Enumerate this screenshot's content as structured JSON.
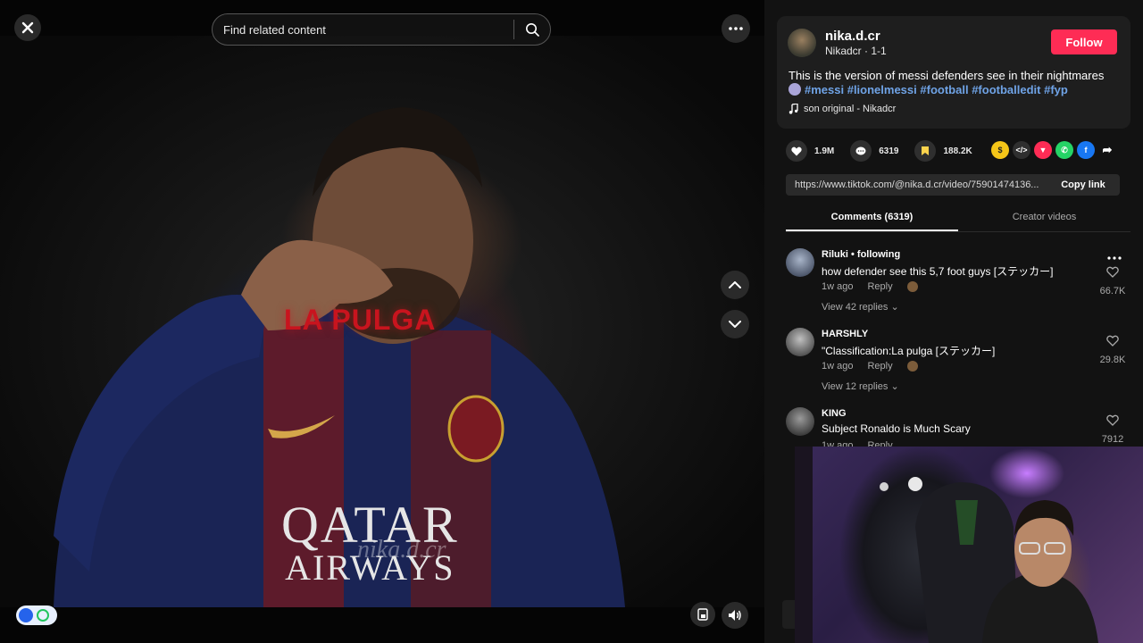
{
  "header": {
    "search_placeholder": "Find related content"
  },
  "video": {
    "overlay_text": "LA PULGA",
    "sponsor_line1": "QATAR",
    "sponsor_line2": "AIRWAYS",
    "watermark": "nika.d.cr"
  },
  "author": {
    "username": "nika.d.cr",
    "subtitle": "Nikadcr · 1-1",
    "follow_label": "Follow"
  },
  "post": {
    "description": "This is the version of messi defenders see in their nightmares",
    "hashtags": [
      "#messi",
      "#lionelmessi",
      "#football",
      "#footballedit",
      "#fyp"
    ],
    "music": "son original - Nikadcr"
  },
  "actions": {
    "likes": "1.9M",
    "comments": "6319",
    "saves": "188.2K"
  },
  "share": {
    "link": "https://www.tiktok.com/@nika.d.cr/video/75901474136...",
    "copy_label": "Copy link"
  },
  "tabs": [
    {
      "label": "Comments (6319)",
      "active": true
    },
    {
      "label": "Creator videos",
      "active": false
    }
  ],
  "comments": [
    {
      "user": "Riluki • following",
      "text": "how defender see this 5,7 foot guys [ステッカー]",
      "time": "1w ago",
      "reply_label": "Reply",
      "replies": "View 42 replies",
      "likes": "66.7K"
    },
    {
      "user": "HARSHLY",
      "text": "\"Classification:La pulga [ステッカー]",
      "time": "1w ago",
      "reply_label": "Reply",
      "replies": "View 12 replies",
      "likes": "29.8K"
    },
    {
      "user": "KING",
      "text": "Subject Ronaldo is Much Scary",
      "time": "1w ago",
      "reply_label": "Reply",
      "replies": "",
      "likes": "7912"
    }
  ],
  "colors": {
    "accent": "#fe2c55",
    "hashtag": "#6fa3e6",
    "panel_bg": "#121212"
  }
}
